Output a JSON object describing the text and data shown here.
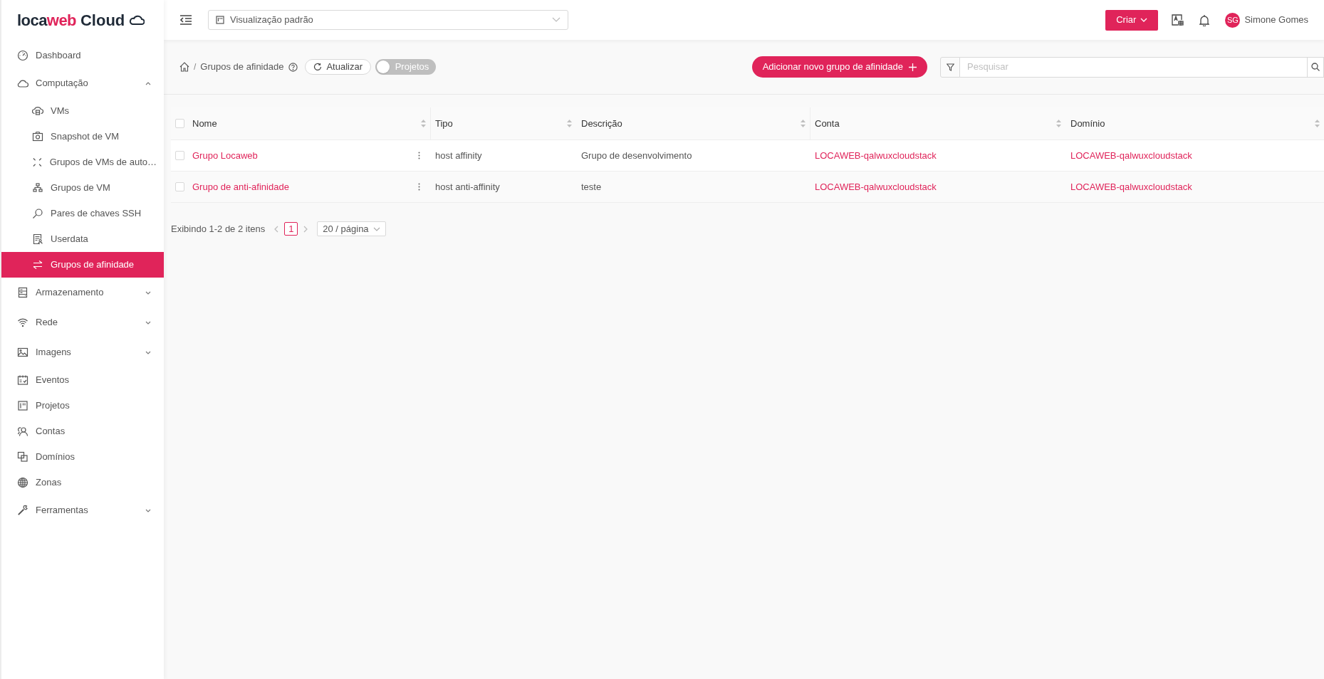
{
  "logo": {
    "prefix": "loca",
    "accent": "web",
    "suffix": "Cloud"
  },
  "sidebar": {
    "items": [
      {
        "label": "Dashboard",
        "kind": "item",
        "selected": false
      },
      {
        "label": "Computação",
        "kind": "group",
        "expanded": true,
        "selected": false,
        "children": [
          {
            "label": "VMs",
            "selected": false
          },
          {
            "label": "Snapshot de VM",
            "selected": false
          },
          {
            "label": "Grupos de VMs de auto…",
            "selected": false
          },
          {
            "label": "Grupos de VM",
            "selected": false
          },
          {
            "label": "Pares de chaves SSH",
            "selected": false
          },
          {
            "label": "Userdata",
            "selected": false
          },
          {
            "label": "Grupos de afinidade",
            "selected": true
          }
        ]
      },
      {
        "label": "Armazenamento",
        "kind": "group",
        "expanded": false,
        "selected": false
      },
      {
        "label": "Rede",
        "kind": "group",
        "expanded": false,
        "selected": false
      },
      {
        "label": "Imagens",
        "kind": "group",
        "expanded": false,
        "selected": false
      },
      {
        "label": "Eventos",
        "kind": "item",
        "selected": false
      },
      {
        "label": "Projetos",
        "kind": "item",
        "selected": false
      },
      {
        "label": "Contas",
        "kind": "item",
        "selected": false
      },
      {
        "label": "Domínios",
        "kind": "item",
        "selected": false
      },
      {
        "label": "Zonas",
        "kind": "item",
        "selected": false
      },
      {
        "label": "Ferramentas",
        "kind": "group",
        "expanded": false,
        "selected": false
      }
    ]
  },
  "header": {
    "view_select": {
      "value": "Visualização padrão"
    },
    "create_button": "Criar",
    "user": {
      "initials": "SG",
      "name": "Simone Gomes"
    }
  },
  "toolbar": {
    "breadcrumb_separator": "/",
    "breadcrumb": "Grupos de afinidade",
    "refresh_button": "Atualizar",
    "projects_toggle": {
      "label": "Projetos",
      "on": false
    },
    "add_button": "Adicionar novo grupo de afinidade",
    "search": {
      "placeholder": "Pesquisar"
    }
  },
  "table": {
    "columns": [
      "Nome",
      "Tipo",
      "Descrição",
      "Conta",
      "Domínio"
    ],
    "select_all": {
      "checked": false
    },
    "rows": [
      {
        "checked": false,
        "cells": [
          "Grupo Locaweb",
          "host affinity",
          "Grupo de desenvolvimento",
          "LOCAWEB-qalwuxcloudstack",
          "LOCAWEB-qalwuxcloudstack"
        ]
      },
      {
        "checked": false,
        "cells": [
          "Grupo de anti-afinidade",
          "host anti-affinity",
          "teste",
          "LOCAWEB-qalwuxcloudstack",
          "LOCAWEB-qalwuxcloudstack"
        ]
      }
    ]
  },
  "pagination": {
    "summary": "Exibindo 1-2 de 2 itens",
    "pages": [
      {
        "label": "1",
        "selected": true
      }
    ],
    "page_size": "20 / página"
  }
}
